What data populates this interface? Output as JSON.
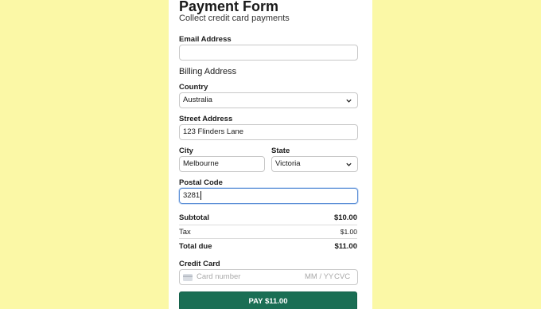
{
  "form": {
    "title": "Payment Form",
    "subtitle": "Collect credit card payments"
  },
  "email": {
    "label": "Email Address",
    "value": ""
  },
  "billing": {
    "heading": "Billing Address",
    "country_label": "Country",
    "country_value": "Australia",
    "street_label": "Street Address",
    "street_value": "123 Flinders Lane",
    "city_label": "City",
    "city_value": "Melbourne",
    "state_label": "State",
    "state_value": "Victoria",
    "postal_label": "Postal Code",
    "postal_value": "3281"
  },
  "summary": {
    "subtotal_label": "Subtotal",
    "subtotal_value": "$10.00",
    "tax_label": "Tax",
    "tax_value": "$1.00",
    "total_label": "Total due",
    "total_value": "$11.00"
  },
  "card": {
    "label": "Credit Card",
    "number_placeholder": "Card number",
    "expiry_placeholder": "MM / YY",
    "cvc_placeholder": "CVC",
    "icon": "credit-card-icon"
  },
  "pay_button": {
    "label": "PAY $11.00"
  },
  "colors": {
    "background": "#fbf8a6",
    "button": "#1a6e54",
    "focus": "#5c8fd6"
  }
}
